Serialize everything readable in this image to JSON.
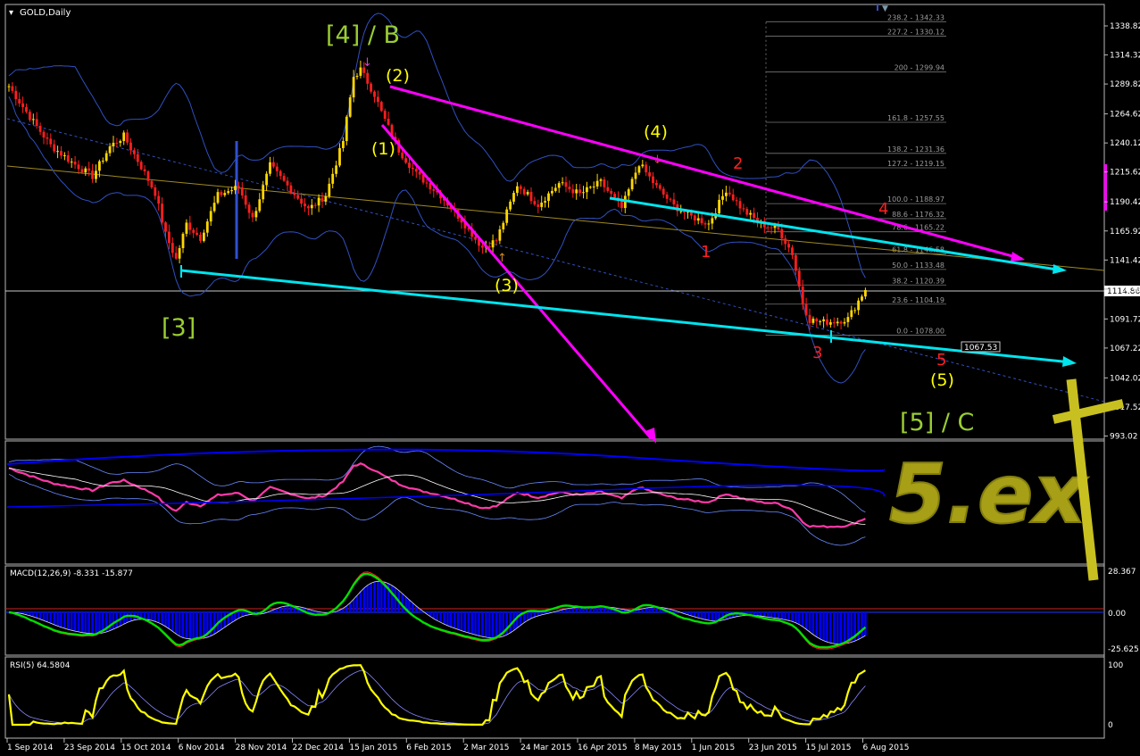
{
  "chart_data": {
    "type": "candlestick",
    "symbol_title": "GOLD,Daily",
    "price_axis": {
      "ticks": [
        "1338.82",
        "1314.32",
        "1289.82",
        "1264.62",
        "1240.12",
        "1215.62",
        "1190.42",
        "1165.92",
        "1141.42",
        "1116.92",
        "1091.72",
        "1067.22",
        "1042.02",
        "1017.52",
        "993.02"
      ],
      "current_price": "1114.86",
      "range": [
        993.02,
        1349.2
      ]
    },
    "date_axis": {
      "labels": [
        "1 Sep 2014",
        "23 Sep 2014",
        "15 Oct 2014",
        "6 Nov 2014",
        "28 Nov 2014",
        "22 Dec 2014",
        "15 Jan 2015",
        "6 Feb 2015",
        "2 Mar 2015",
        "24 Mar 2015",
        "16 Apr 2015",
        "8 May 2015",
        "1 Jun 2015",
        "23 Jun 2015",
        "15 Jul 2015",
        "6 Aug 2015"
      ]
    },
    "price_path": [
      {
        "bar": 0,
        "price": 1288
      },
      {
        "bar": 6,
        "price": 1262
      },
      {
        "bar": 12,
        "price": 1238
      },
      {
        "bar": 18,
        "price": 1224
      },
      {
        "bar": 24,
        "price": 1212
      },
      {
        "bar": 29,
        "price": 1237
      },
      {
        "bar": 33,
        "price": 1246
      },
      {
        "bar": 38,
        "price": 1220
      },
      {
        "bar": 42,
        "price": 1198
      },
      {
        "bar": 45,
        "price": 1163
      },
      {
        "bar": 48,
        "price": 1142
      },
      {
        "bar": 51,
        "price": 1172
      },
      {
        "bar": 55,
        "price": 1160
      },
      {
        "bar": 60,
        "price": 1196
      },
      {
        "bar": 66,
        "price": 1203
      },
      {
        "bar": 70,
        "price": 1176
      },
      {
        "bar": 75,
        "price": 1221
      },
      {
        "bar": 80,
        "price": 1204
      },
      {
        "bar": 86,
        "price": 1184
      },
      {
        "bar": 91,
        "price": 1196
      },
      {
        "bar": 96,
        "price": 1242
      },
      {
        "bar": 99,
        "price": 1296
      },
      {
        "bar": 101,
        "price": 1302
      },
      {
        "bar": 105,
        "price": 1281
      },
      {
        "bar": 107,
        "price": 1266
      },
      {
        "bar": 112,
        "price": 1234
      },
      {
        "bar": 117,
        "price": 1214
      },
      {
        "bar": 124,
        "price": 1196
      },
      {
        "bar": 130,
        "price": 1175
      },
      {
        "bar": 136,
        "price": 1152
      },
      {
        "bar": 140,
        "price": 1158
      },
      {
        "bar": 146,
        "price": 1205
      },
      {
        "bar": 152,
        "price": 1188
      },
      {
        "bar": 158,
        "price": 1206
      },
      {
        "bar": 164,
        "price": 1197
      },
      {
        "bar": 170,
        "price": 1207
      },
      {
        "bar": 176,
        "price": 1185
      },
      {
        "bar": 181,
        "price": 1223
      },
      {
        "bar": 186,
        "price": 1203
      },
      {
        "bar": 191,
        "price": 1187
      },
      {
        "bar": 196,
        "price": 1178
      },
      {
        "bar": 201,
        "price": 1172
      },
      {
        "bar": 206,
        "price": 1201
      },
      {
        "bar": 211,
        "price": 1183
      },
      {
        "bar": 216,
        "price": 1172
      },
      {
        "bar": 221,
        "price": 1167
      },
      {
        "bar": 225,
        "price": 1147
      },
      {
        "bar": 228,
        "price": 1105
      },
      {
        "bar": 230,
        "price": 1091
      },
      {
        "bar": 234,
        "price": 1089
      },
      {
        "bar": 238,
        "price": 1090
      },
      {
        "bar": 241,
        "price": 1092
      },
      {
        "bar": 244,
        "price": 1107
      },
      {
        "bar": 246,
        "price": 1117
      }
    ],
    "fibonacci_levels": [
      {
        "label": "238.2 - 1342.33",
        "price": 1342.33
      },
      {
        "label": "227.2 - 1330.12",
        "price": 1330.12
      },
      {
        "label": "200 - 1299.94",
        "price": 1299.94
      },
      {
        "label": "161.8 - 1257.55",
        "price": 1257.55
      },
      {
        "label": "138.2 - 1231.36",
        "price": 1231.36
      },
      {
        "label": "127.2 - 1219.15",
        "price": 1219.15
      },
      {
        "label": "100.0 - 1188.97",
        "price": 1188.97
      },
      {
        "label": "88.6 - 1176.32",
        "price": 1176.32
      },
      {
        "label": "78.6 - 1165.22",
        "price": 1165.22
      },
      {
        "label": "61.8 - 1146.58",
        "price": 1146.58
      },
      {
        "label": "50.0 - 1133.48",
        "price": 1133.48
      },
      {
        "label": "38.2 - 1120.39",
        "price": 1120.39
      },
      {
        "label": "23.6 - 1104.19",
        "price": 1104.19
      },
      {
        "label": "0.0 - 1078.00",
        "price": 1078.0
      }
    ],
    "price_box_label": "1067.53",
    "wave_labels": [
      {
        "text": "[4] / B",
        "color": "#9acd32"
      },
      {
        "text": "(2)",
        "color": "#ffff00"
      },
      {
        "text": "(1)",
        "color": "#ffff00"
      },
      {
        "text": "(3)",
        "color": "#ffff00"
      },
      {
        "text": "(4)",
        "color": "#ffff00"
      },
      {
        "text": "2",
        "color": "#ff2020"
      },
      {
        "text": "1",
        "color": "#ff2020"
      },
      {
        "text": "4",
        "color": "#ff2020"
      },
      {
        "text": "3",
        "color": "#ff2020"
      },
      {
        "text": "5",
        "color": "#ff2020"
      },
      {
        "text": "(5)",
        "color": "#ffff00"
      },
      {
        "text": "[3]",
        "color": "#9acd32"
      },
      {
        "text": "[5] / C",
        "color": "#9acd32"
      }
    ],
    "annotation_handwritten": "5.ex",
    "indicators": [
      {
        "name": "bands-ma",
        "series_colors": [
          "#ff3aa8",
          "#ffffff",
          "#0000ff"
        ]
      },
      {
        "name": "MACD",
        "label": "MACD(12,26,9) -8.331 -15.877",
        "ticks": [
          "28.367",
          "0.00",
          "-25.625"
        ],
        "colors": {
          "macd": "#00e000",
          "signal": "#ff2020",
          "histogram": "#0000ff"
        }
      },
      {
        "name": "RSI",
        "label": "RSI(5) 64.5804",
        "ticks": [
          "100",
          "0"
        ],
        "color": "#ffff00"
      }
    ],
    "colors": {
      "bull_candle": "#ffd700",
      "bear_candle": "#ff1e1e",
      "channel_magenta": "#ff00ff",
      "trendline_cyan": "#00e5ee",
      "band": "#3050c0"
    }
  }
}
